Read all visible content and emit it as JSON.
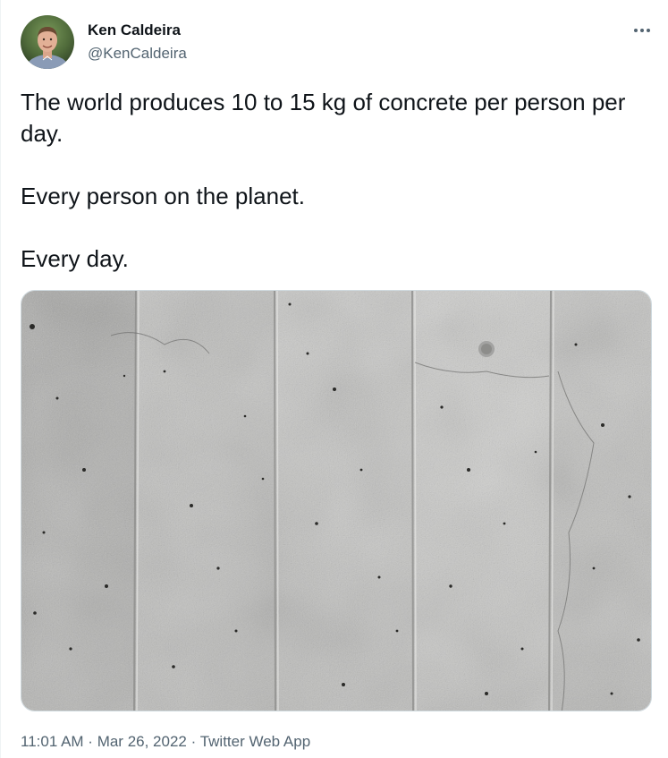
{
  "tweet": {
    "author": {
      "name": "Ken Caldeira",
      "handle": "@KenCaldeira",
      "avatar_icon": "person-photo-avatar"
    },
    "more_icon": "more-horizontal-icon",
    "text": {
      "paragraphs": [
        "The world produces 10 to 15 kg of concrete per person per day.",
        "Every person on the planet.",
        "Every day."
      ]
    },
    "media": {
      "description_icon": "concrete-wall-photo"
    },
    "meta": {
      "time": "11:01 AM",
      "separator": " · ",
      "date": "Mar 26, 2022",
      "source": "Twitter Web App"
    }
  },
  "colors": {
    "text_primary": "#0f1419",
    "text_secondary": "#536471",
    "border": "#cfd9de",
    "concrete": "#b9b9b7"
  }
}
